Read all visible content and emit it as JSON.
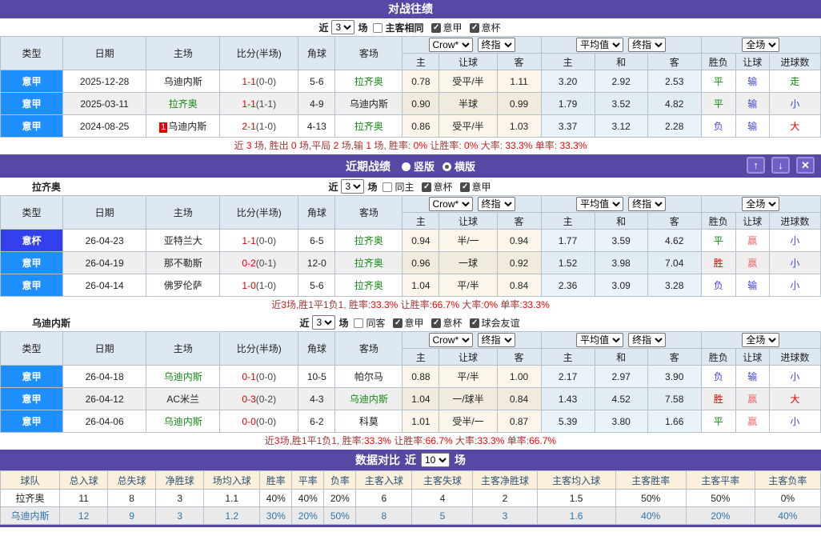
{
  "colors": {
    "purple": "#5648A5",
    "serie_a_blue": "#1E8FFF",
    "coppa_blue": "#3340EE",
    "team_green": "#128a12",
    "score_red": "#E60000",
    "loss_blue": "#4343EE",
    "win_red": "#EE6A6A",
    "summary_value_red": "#FF0000"
  },
  "labels": {
    "near": "近",
    "games": "场"
  },
  "cols": {
    "type": "类型",
    "date": "日期",
    "home": "主场",
    "score": "比分(半场)",
    "corner": "角球",
    "away": "客场",
    "h": "主",
    "hcap": "让球",
    "a": "客",
    "h2": "主",
    "d2": "和",
    "a2": "客",
    "wdl": "胜负",
    "hcap2": "让球",
    "goals": "进球数"
  },
  "dd": {
    "crow": "Crow*",
    "final": "终指",
    "avg": "平均值",
    "final2": "终指",
    "full": "全场"
  },
  "h2h": {
    "title": "对战往绩",
    "filter": {
      "value": "3",
      "boxes": [
        {
          "label": "主客相同",
          "checked": false,
          "bold": true
        },
        {
          "label": "意甲",
          "checked": true,
          "bold": false
        },
        {
          "label": "意杯",
          "checked": true,
          "bold": false
        }
      ]
    },
    "rows": [
      {
        "type": "意甲",
        "lg": "jia",
        "date": "2025-12-28",
        "home": "乌迪内斯",
        "home_cls": "",
        "badge": "",
        "ft": "1-1",
        "ht": "(0-0)",
        "corner": "5-6",
        "away": "拉齐奥",
        "away_cls": "green",
        "o1": "0.78",
        "hc": "受平/半",
        "o2": "1.11",
        "m1": "3.20",
        "m2": "2.92",
        "m3": "2.53",
        "r1": "平",
        "r1c": "green",
        "r2": "输",
        "r2c": "blue",
        "r3": "走",
        "r3c": "green"
      },
      {
        "type": "意甲",
        "lg": "jia",
        "date": "2025-03-11",
        "home": "拉齐奥",
        "home_cls": "green",
        "badge": "",
        "ft": "1-1",
        "ht": "(1-1)",
        "corner": "4-9",
        "away": "乌迪内斯",
        "away_cls": "",
        "o1": "0.90",
        "hc": "半球",
        "o2": "0.99",
        "m1": "1.79",
        "m2": "3.52",
        "m3": "4.82",
        "r1": "平",
        "r1c": "green",
        "r2": "输",
        "r2c": "blue",
        "r3": "小",
        "r3c": "blue"
      },
      {
        "type": "意甲",
        "lg": "jia",
        "date": "2024-08-25",
        "home": "乌迪内斯",
        "home_cls": "",
        "badge": "1",
        "ft": "2-1",
        "ht": "(1-0)",
        "corner": "4-13",
        "away": "拉齐奥",
        "away_cls": "green",
        "o1": "0.86",
        "hc": "受平/半",
        "o2": "1.03",
        "m1": "3.37",
        "m2": "3.12",
        "m3": "2.28",
        "r1": "负",
        "r1c": "blue",
        "r2": "输",
        "r2c": "blue",
        "r3": "大",
        "r3c": "red"
      }
    ],
    "summary": [
      {
        "t": "近 ",
        "c": "k"
      },
      {
        "t": "3",
        "c": "r"
      },
      {
        "t": " 场, 胜出 ",
        "c": "k"
      },
      {
        "t": "0",
        "c": "r"
      },
      {
        "t": " 场,平局 ",
        "c": "k"
      },
      {
        "t": "2",
        "c": "r"
      },
      {
        "t": " 场,输 ",
        "c": "k"
      },
      {
        "t": "1",
        "c": "r"
      },
      {
        "t": " 场, 胜率: ",
        "c": "k"
      },
      {
        "t": "0%",
        "c": "r"
      },
      {
        "t": " 让胜率: ",
        "c": "k"
      },
      {
        "t": "0%",
        "c": "r"
      },
      {
        "t": " 大率: ",
        "c": "k"
      },
      {
        "t": "33.3%",
        "c": "r"
      },
      {
        "t": " 单率: ",
        "c": "k"
      },
      {
        "t": "33.3%",
        "c": "r"
      }
    ]
  },
  "recent": {
    "title": "近期战绩",
    "radios": [
      {
        "label": "竖版",
        "selected": false
      },
      {
        "label": "横版",
        "selected": true
      }
    ],
    "buttons": {
      "up": "↑",
      "down": "↓",
      "close": "✕"
    },
    "lazio": {
      "team": "拉齐奥",
      "filter": {
        "value": "3",
        "boxes": [
          {
            "label": "同主",
            "checked": false,
            "bold": false
          },
          {
            "label": "意杯",
            "checked": true,
            "bold": false
          },
          {
            "label": "意甲",
            "checked": true,
            "bold": false
          }
        ]
      },
      "rows": [
        {
          "type": "意杯",
          "lg": "bei",
          "date": "26-04-23",
          "home": "亚特兰大",
          "home_cls": "",
          "badge": "",
          "ft": "1-1",
          "ht": "(0-0)",
          "corner": "6-5",
          "away": "拉齐奥",
          "away_cls": "green",
          "o1": "0.94",
          "hc": "半/一",
          "o2": "0.94",
          "m1": "1.77",
          "m2": "3.59",
          "m3": "4.62",
          "r1": "平",
          "r1c": "green",
          "r2": "赢",
          "r2c": "winred",
          "r3": "小",
          "r3c": "blue"
        },
        {
          "type": "意甲",
          "lg": "jia",
          "date": "26-04-19",
          "home": "那不勒斯",
          "home_cls": "",
          "badge": "",
          "ft": "0-2",
          "ht": "(0-1)",
          "corner": "12-0",
          "away": "拉齐奥",
          "away_cls": "green",
          "o1": "0.96",
          "hc": "一球",
          "o2": "0.92",
          "m1": "1.52",
          "m2": "3.98",
          "m3": "7.04",
          "r1": "胜",
          "r1c": "red",
          "r2": "赢",
          "r2c": "winred",
          "r3": "小",
          "r3c": "blue"
        },
        {
          "type": "意甲",
          "lg": "jia",
          "date": "26-04-14",
          "home": "佛罗伦萨",
          "home_cls": "",
          "badge": "",
          "ft": "1-0",
          "ht": "(1-0)",
          "corner": "5-6",
          "away": "拉齐奥",
          "away_cls": "green",
          "o1": "1.04",
          "hc": "平/半",
          "o2": "0.84",
          "m1": "2.36",
          "m2": "3.09",
          "m3": "3.28",
          "r1": "负",
          "r1c": "blue",
          "r2": "输",
          "r2c": "blue",
          "r3": "小",
          "r3c": "blue"
        }
      ],
      "summary": [
        {
          "t": "近",
          "c": "k"
        },
        {
          "t": "3",
          "c": "r"
        },
        {
          "t": "场,胜1平1负1, 胜率:",
          "c": "k"
        },
        {
          "t": "33.3%",
          "c": "r"
        },
        {
          "t": " 让胜率:",
          "c": "k"
        },
        {
          "t": "66.7%",
          "c": "r"
        },
        {
          "t": " 大率:",
          "c": "k"
        },
        {
          "t": "0%",
          "c": "r"
        },
        {
          "t": " 单率:",
          "c": "k"
        },
        {
          "t": "33.3%",
          "c": "r"
        }
      ]
    },
    "udinese": {
      "team": "乌迪内斯",
      "filter": {
        "value": "3",
        "boxes": [
          {
            "label": "同客",
            "checked": false,
            "bold": false
          },
          {
            "label": "意甲",
            "checked": true,
            "bold": false
          },
          {
            "label": "意杯",
            "checked": true,
            "bold": false
          },
          {
            "label": "球会友谊",
            "checked": true,
            "bold": false
          }
        ]
      },
      "rows": [
        {
          "type": "意甲",
          "lg": "jia",
          "date": "26-04-18",
          "home": "乌迪内斯",
          "home_cls": "green",
          "badge": "",
          "ft": "0-1",
          "ht": "(0-0)",
          "corner": "10-5",
          "away": "帕尔马",
          "away_cls": "",
          "o1": "0.88",
          "hc": "平/半",
          "o2": "1.00",
          "m1": "2.17",
          "m2": "2.97",
          "m3": "3.90",
          "r1": "负",
          "r1c": "blue",
          "r2": "输",
          "r2c": "blue",
          "r3": "小",
          "r3c": "blue"
        },
        {
          "type": "意甲",
          "lg": "jia",
          "date": "26-04-12",
          "home": "AC米兰",
          "home_cls": "",
          "badge": "",
          "ft": "0-3",
          "ht": "(0-2)",
          "corner": "4-3",
          "away": "乌迪内斯",
          "away_cls": "green",
          "o1": "1.04",
          "hc": "一/球半",
          "o2": "0.84",
          "m1": "1.43",
          "m2": "4.52",
          "m3": "7.58",
          "r1": "胜",
          "r1c": "red",
          "r2": "赢",
          "r2c": "winred",
          "r3": "大",
          "r3c": "red"
        },
        {
          "type": "意甲",
          "lg": "jia",
          "date": "26-04-06",
          "home": "乌迪内斯",
          "home_cls": "green",
          "badge": "",
          "ft": "0-0",
          "ht": "(0-0)",
          "corner": "6-2",
          "away": "科莫",
          "away_cls": "",
          "o1": "1.01",
          "hc": "受半/一",
          "o2": "0.87",
          "m1": "5.39",
          "m2": "3.80",
          "m3": "1.66",
          "r1": "平",
          "r1c": "green",
          "r2": "赢",
          "r2c": "winred",
          "r3": "小",
          "r3c": "blue"
        }
      ],
      "summary": [
        {
          "t": "近",
          "c": "k"
        },
        {
          "t": "3",
          "c": "r"
        },
        {
          "t": "场,胜1平1负1, 胜率:",
          "c": "k"
        },
        {
          "t": "33.3%",
          "c": "r"
        },
        {
          "t": " 让胜率:",
          "c": "k"
        },
        {
          "t": "66.7%",
          "c": "r"
        },
        {
          "t": " 大率:",
          "c": "k"
        },
        {
          "t": "33.3%",
          "c": "r"
        },
        {
          "t": " 单率:",
          "c": "k"
        },
        {
          "t": "66.7%",
          "c": "r"
        }
      ]
    }
  },
  "compare": {
    "title": "数据对比",
    "filter": {
      "value": "10"
    },
    "headers": [
      "球队",
      "总入球",
      "总失球",
      "净胜球",
      "场均入球",
      "胜率",
      "平率",
      "负率",
      "主客入球",
      "主客失球",
      "主客净胜球",
      "主客均入球",
      "主客胜率",
      "主客平率",
      "主客负率"
    ],
    "rows": [
      {
        "team": "拉齐奥",
        "vals": [
          "11",
          "8",
          "3",
          "1.1",
          "40%",
          "40%",
          "20%",
          "6",
          "4",
          "2",
          "1.5",
          "50%",
          "50%",
          "0%"
        ]
      },
      {
        "team": "乌迪内斯",
        "vals": [
          "12",
          "9",
          "3",
          "1.2",
          "30%",
          "20%",
          "50%",
          "8",
          "5",
          "3",
          "1.6",
          "40%",
          "20%",
          "40%"
        ]
      }
    ]
  }
}
